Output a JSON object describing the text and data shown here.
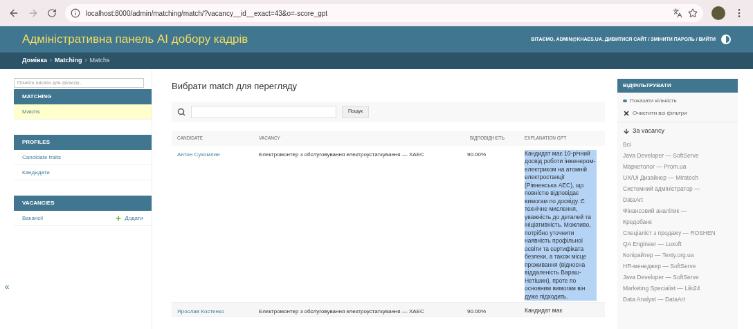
{
  "browser": {
    "url": "localhost:8000/admin/matching/match/?vacancy__id__exact=43&o=-score_gpt"
  },
  "header": {
    "title": "Адміністративна панель AI добору кадрів",
    "user_tools": "ВІТАЄМО, ADMIN@KHAES.UA. ДИВИТИСЯ САЙТ / ЗМІНИТИ ПАРОЛЬ / ВИЙТИ"
  },
  "breadcrumbs": {
    "separator": "›",
    "items": [
      "Домівка",
      "Matching",
      "Matchs"
    ]
  },
  "sidebar": {
    "filter_placeholder": "Почніть писати для фільтру...",
    "collapse": "«",
    "sections": [
      {
        "title": "MATCHING",
        "items": [
          {
            "label": "Matchs",
            "selected": true
          }
        ]
      },
      {
        "title": "PROFILES",
        "items": [
          {
            "label": "Candidate traits",
            "selected": false
          },
          {
            "label": "Кандидати",
            "selected": false
          }
        ]
      },
      {
        "title": "VACANCIES",
        "items": [
          {
            "label": "Вакансії",
            "selected": false,
            "add": "Додати"
          }
        ]
      }
    ]
  },
  "content": {
    "title": "Вибрати match для перегляду",
    "search_button": "Пошук",
    "table": {
      "columns": [
        "CANDIDATE",
        "VACANCY",
        "ВІДПОВІДНІСТЬ",
        "EXPLANATION GPT"
      ],
      "rows": [
        {
          "candidate": "Антон Сухомлин",
          "vacancy": "Електромонтер з обслуговування електроустаткування — ХАЕС",
          "score": "90.00%",
          "explanation": "Кандидат має 10-річний досвід роботи інженером-електриком на атомній електростанції (Рівненська АЕС), що повністю відповідає вимогам по досвіду. Є технічне мислення, уважність до деталей та ініціативність. Можливо, потрібно уточнити наявність профільної освіти та сертифіката безпеки, а також місце проживання (відносна віддаленість Вараш-Нетішин), проте по основним вимогам він дуже підходить.",
          "highlighted": true
        },
        {
          "candidate": "Ярослав Костенко",
          "vacancy": "Електромонтер з обслуговування електроустаткування — ХАЕС",
          "score": "90.00%",
          "explanation": "Кандидат має",
          "highlighted": false
        }
      ]
    }
  },
  "filter": {
    "title": "ВІДФІЛЬТРУВАТИ",
    "show_counts": "Показати кількість",
    "clear": "Очистити всі фільтри",
    "group": "За vacancy",
    "options": [
      "Всі",
      "Java Developer — SoftServe",
      "Маркетолог — Prom.ua",
      "UX/UI Дизайнер — Miratech",
      "Системний адміністратор — DataArt",
      "Фінансовий аналітик — Кредобанк",
      "Спеціаліст з продажу — ROSHEN",
      "QA Engineer — Luxoft",
      "Копірайтер — Texty.org.ua",
      "HR-менеджер — SoftServe",
      "Java Developer — SoftServe",
      "Marketing Specialist — Liki24",
      "Data Analyst — DataArt"
    ]
  }
}
